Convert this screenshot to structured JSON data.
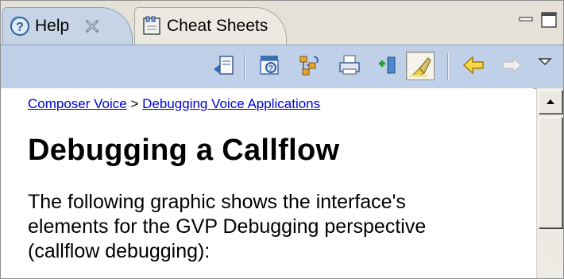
{
  "tabs": [
    {
      "label": "Help",
      "icon": "help-icon",
      "active": true
    },
    {
      "label": "Cheat Sheets",
      "icon": "cheat-sheets-icon",
      "active": false
    }
  ],
  "window_controls": [
    "minimize-icon",
    "maximize-icon"
  ],
  "toolbar": {
    "items": [
      "show-in-contents-icon",
      "search-icon",
      "show-all-topics-icon",
      "print-icon",
      "add-bookmark-icon",
      "highlight-search-icon",
      "back-icon",
      "forward-icon",
      "view-menu-icon"
    ]
  },
  "content": {
    "breadcrumb": {
      "link1": "Composer Voice",
      "separator": ">",
      "link2": "Debugging Voice Applications"
    },
    "title": "Debugging a Callflow",
    "paragraph": {
      "line1": "The following graphic shows the interface's",
      "line2": "elements for the GVP Debugging perspective",
      "line3": "(callflow debugging):"
    }
  },
  "colors": {
    "active_tab": "#c6d4e6",
    "toolbar": "#bfd0e8",
    "link": "#0000e0"
  }
}
